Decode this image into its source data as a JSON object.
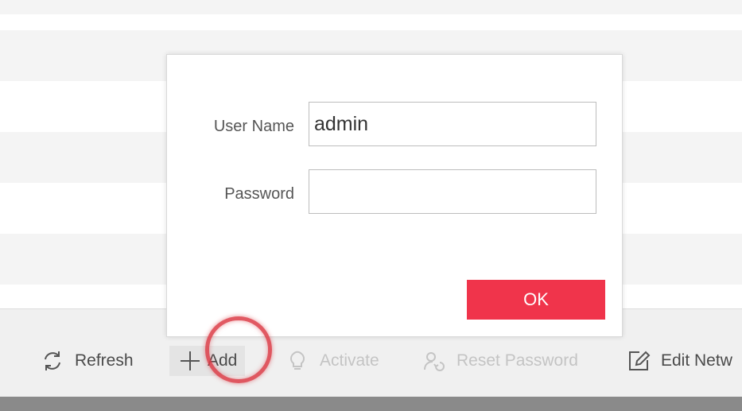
{
  "dialog": {
    "username_label": "User Name",
    "username_value": "admin",
    "password_label": "Password",
    "password_value": "",
    "ok_label": "OK"
  },
  "toolbar": {
    "refresh_label": "Refresh",
    "add_label": "Add",
    "activate_label": "Activate",
    "reset_password_label": "Reset Password",
    "edit_network_label": "Edit Netw"
  },
  "colors": {
    "accent": "#f0344b",
    "highlight_ring": "#dc3c46"
  }
}
